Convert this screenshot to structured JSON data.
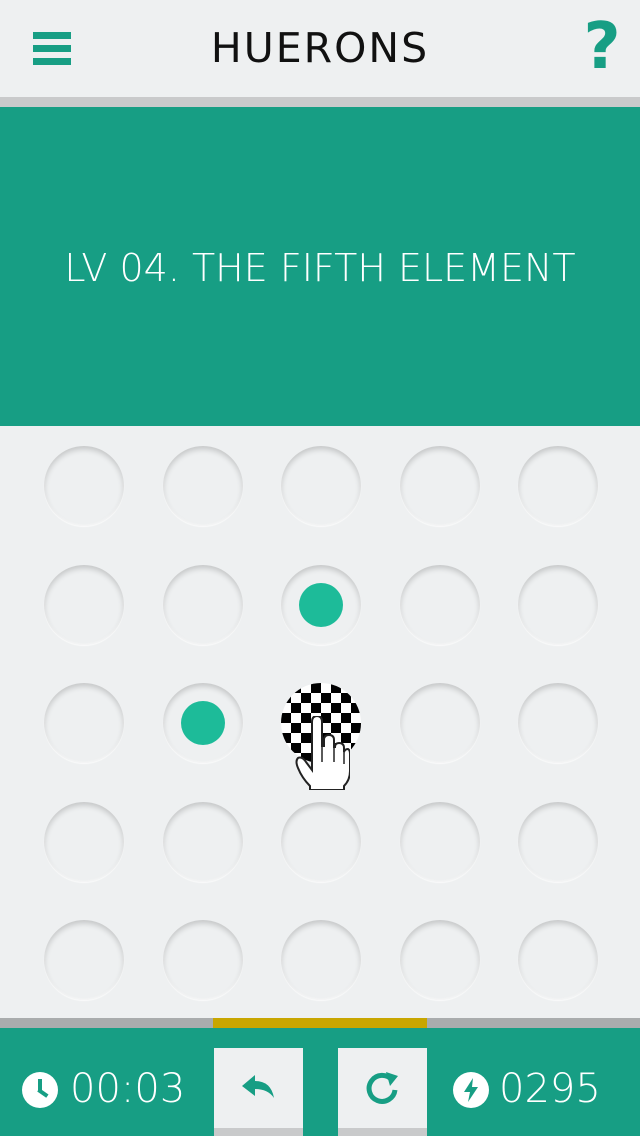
{
  "header": {
    "title": "HUERONS",
    "menu_icon": "hamburger-menu-icon",
    "help_label": "?"
  },
  "banner": {
    "level_title": "LV 04. THE FIFTH ELEMENT"
  },
  "board": {
    "rows": 5,
    "cols": 5,
    "filled_cells": [
      [
        1,
        2
      ],
      [
        2,
        1
      ]
    ],
    "target_cell": [
      2,
      2
    ],
    "target_pattern": "checkered",
    "hint_icon": "pointing-hand-icon"
  },
  "progress": {
    "filled_fraction_start": 0.333,
    "filled_fraction_end": 0.667
  },
  "footer": {
    "timer": "00:03",
    "timer_icon": "clock-icon",
    "undo_icon": "undo-arrow-icon",
    "restart_icon": "restart-icon",
    "score": "0295",
    "score_icon": "lightning-icon"
  },
  "colors": {
    "accent": "#179e84",
    "dot": "#1dbb99",
    "background": "#eef0f1",
    "progress_fill": "#c8a600"
  }
}
